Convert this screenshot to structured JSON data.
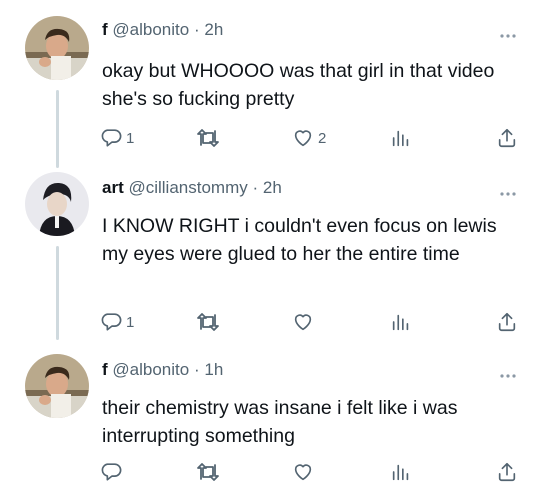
{
  "tweets": [
    {
      "display_name": "f",
      "handle": "@albonito",
      "sep": "·",
      "time": "2h",
      "text": "okay but WHOOOO was that girl in that video she's so fucking pretty",
      "replies": "1",
      "retweets": "",
      "likes": "2",
      "views": ""
    },
    {
      "display_name": "art",
      "handle": "@cillianstommy",
      "sep": "·",
      "time": "2h",
      "text": "I KNOW RIGHT i couldn't even focus on lewis my eyes were glued to her the entire time",
      "replies": "1",
      "retweets": "",
      "likes": "",
      "views": ""
    },
    {
      "display_name": "f",
      "handle": "@albonito",
      "sep": "·",
      "time": "1h",
      "text": "their chemistry was insane i felt like i was interrupting something",
      "replies": "",
      "retweets": "",
      "likes": "",
      "views": ""
    }
  ],
  "icons": {
    "reply": "reply-icon",
    "retweet": "retweet-icon",
    "like": "heart-icon",
    "views": "views-icon",
    "share": "share-icon",
    "more": "more-icon"
  },
  "colors": {
    "text": "#0f1419",
    "secondary": "#536471",
    "thread_line": "#cfd9de"
  }
}
